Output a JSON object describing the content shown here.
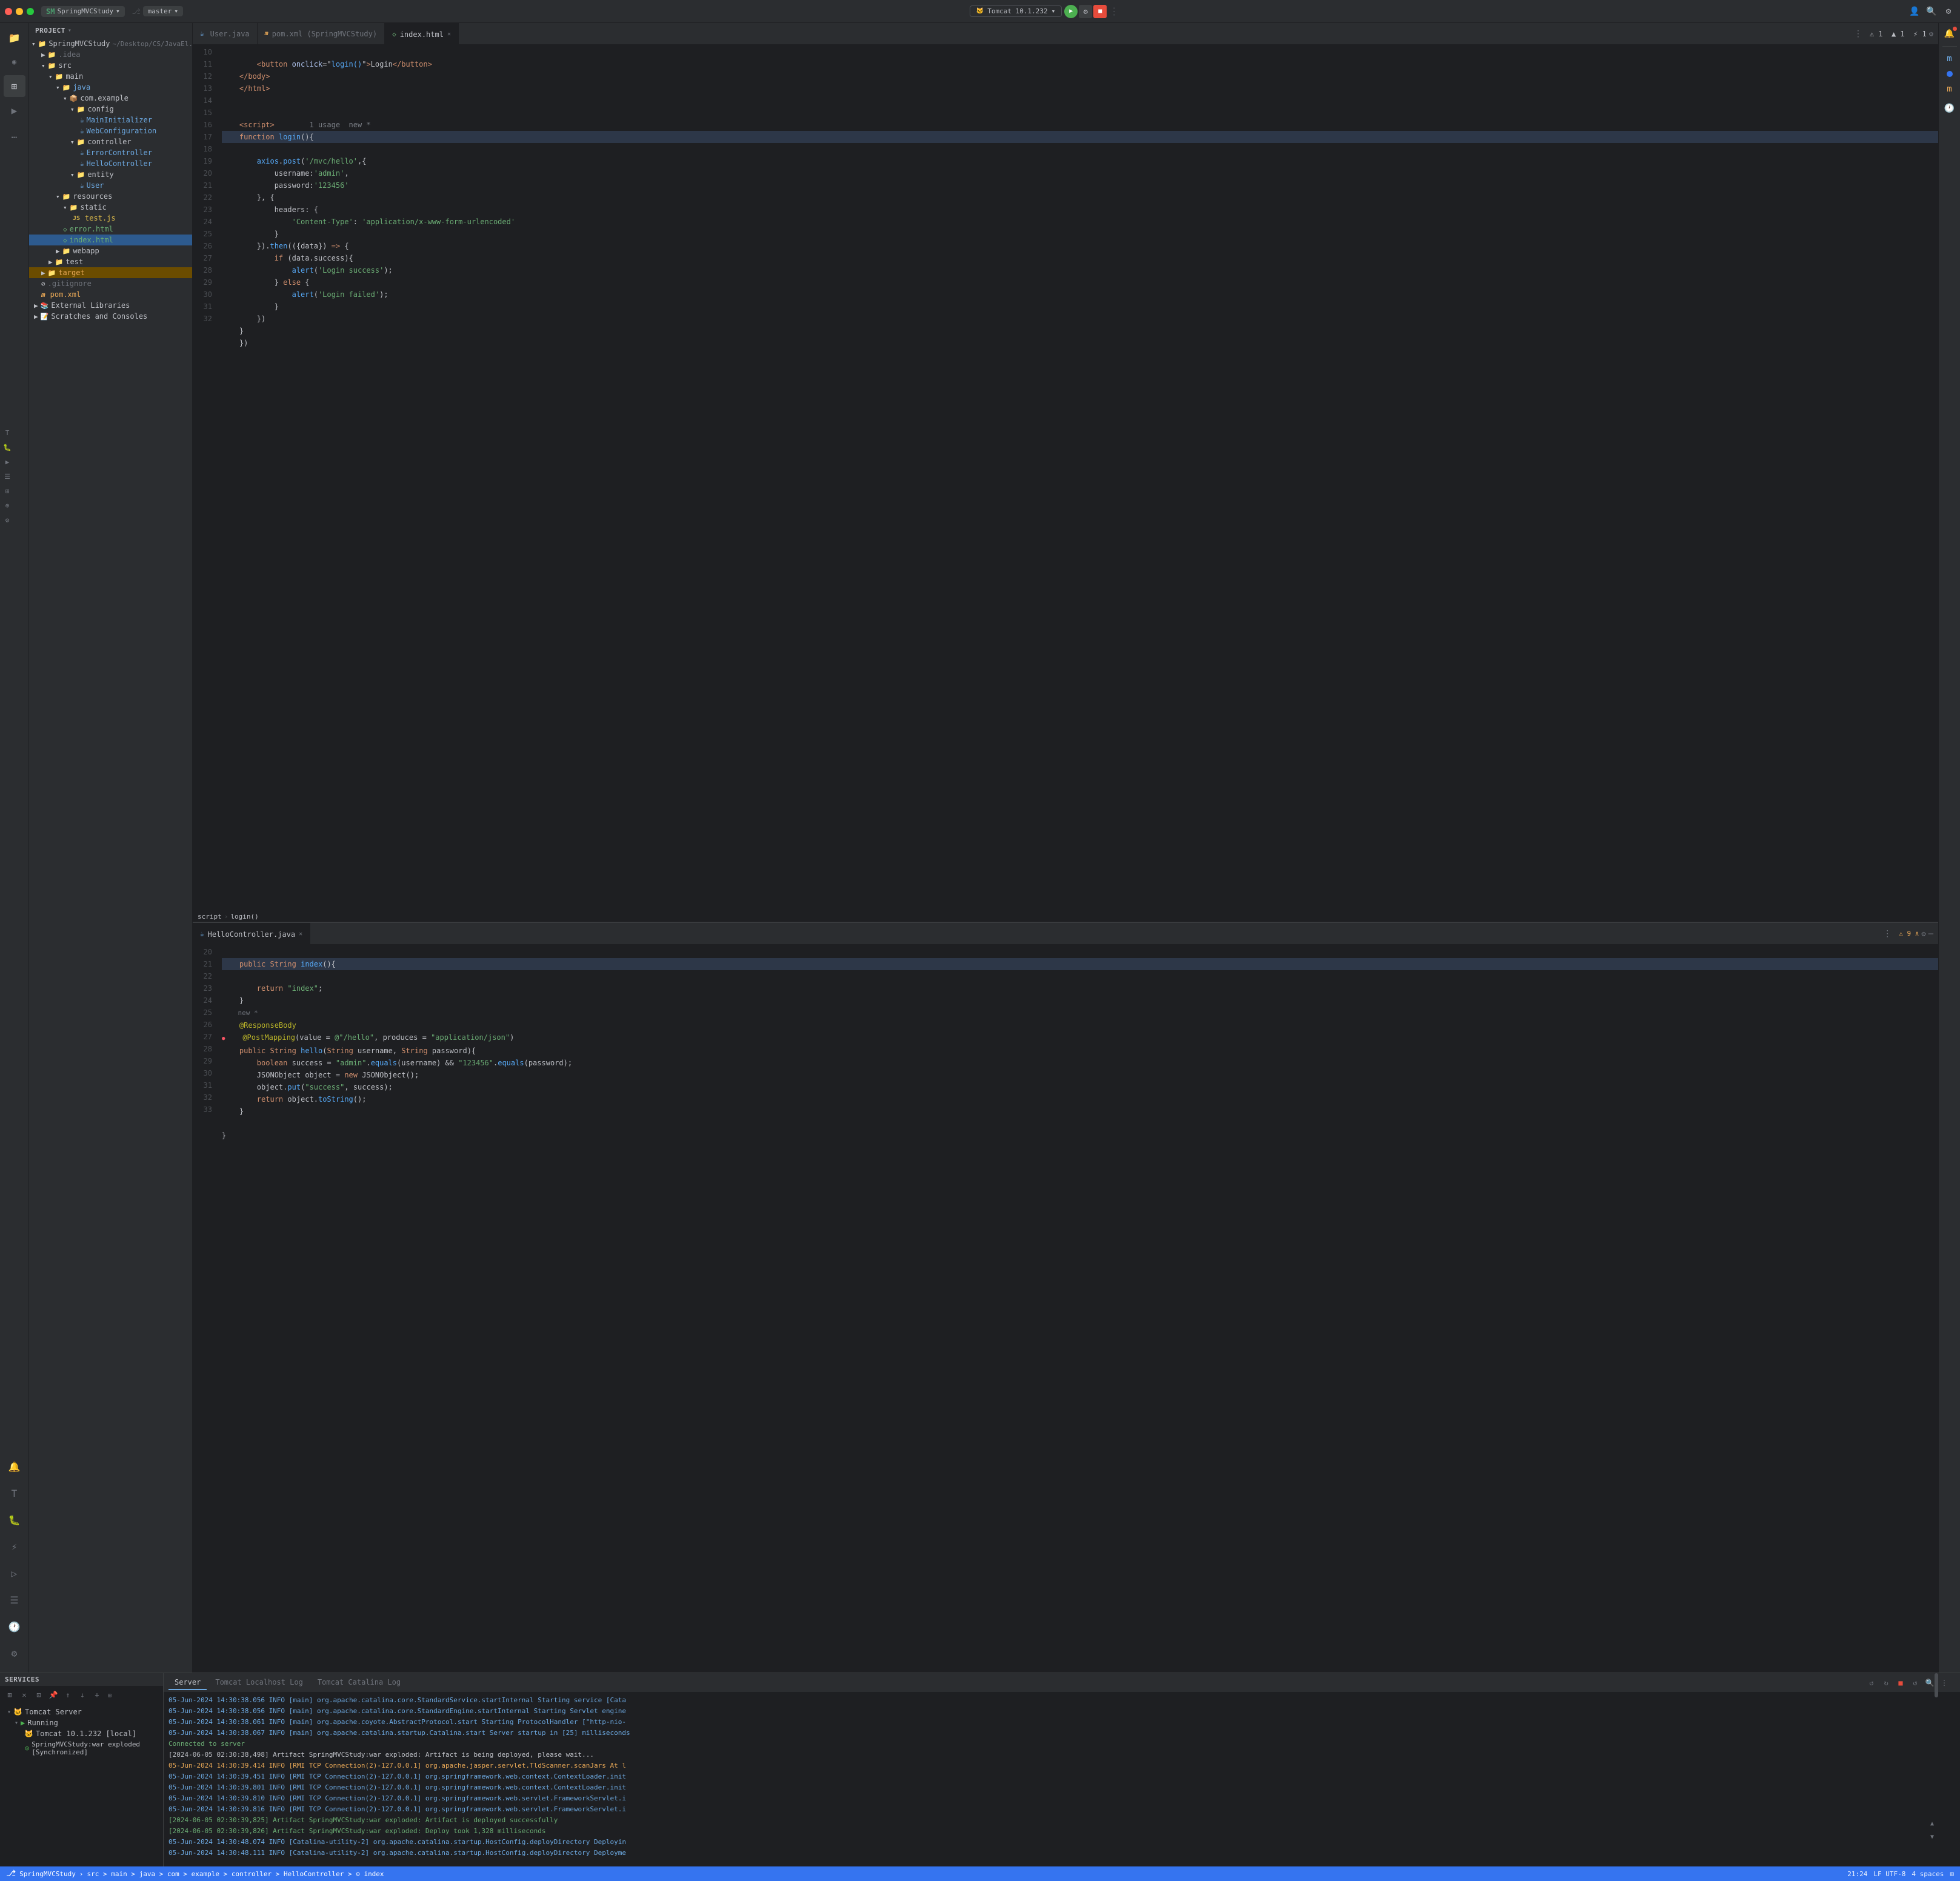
{
  "titlebar": {
    "project_label": "SpringMVCStudy",
    "branch_label": "master",
    "run_config": "Tomcat 10.1.232",
    "chevron": "▼",
    "branch_icon": "⎇"
  },
  "tabs_top": {
    "tab1": {
      "label": "User.java",
      "icon": "☕",
      "active": false
    },
    "tab2": {
      "label": "pom.xml (SpringMVCStudy)",
      "icon": "m",
      "active": false
    },
    "tab3": {
      "label": "index.html",
      "icon": "<>",
      "active": true
    }
  },
  "editor1": {
    "toolbar": {
      "warnings": "⚠ 1  ▲ 1  ⚡ 1  ∧"
    }
  },
  "tabs_mid": {
    "tab1": {
      "label": "HelloController.java",
      "icon": "☕",
      "active": true
    }
  },
  "sidebar": {
    "header": "Project",
    "items": [
      {
        "label": "SpringMVCStudy",
        "path": "~/Desktop/CS/JavaEl",
        "level": 0,
        "icon": "📁",
        "expanded": true
      },
      {
        "label": ".idea",
        "level": 1,
        "icon": "📁",
        "expanded": false
      },
      {
        "label": "src",
        "level": 1,
        "icon": "📁",
        "expanded": true
      },
      {
        "label": "main",
        "level": 2,
        "icon": "📁",
        "expanded": true
      },
      {
        "label": "java",
        "level": 3,
        "icon": "📁",
        "expanded": true
      },
      {
        "label": "com.example",
        "level": 4,
        "icon": "📦",
        "expanded": true
      },
      {
        "label": "config",
        "level": 5,
        "icon": "📁",
        "expanded": true
      },
      {
        "label": "MainInitializer",
        "level": 6,
        "icon": "☕",
        "color": "blue"
      },
      {
        "label": "WebConfiguration",
        "level": 6,
        "icon": "☕",
        "color": "blue"
      },
      {
        "label": "controller",
        "level": 5,
        "icon": "📁",
        "expanded": true
      },
      {
        "label": "ErrorController",
        "level": 6,
        "icon": "☕",
        "color": "blue"
      },
      {
        "label": "HelloController",
        "level": 6,
        "icon": "☕",
        "color": "blue"
      },
      {
        "label": "entity",
        "level": 5,
        "icon": "📁",
        "expanded": true
      },
      {
        "label": "User",
        "level": 6,
        "icon": "☕",
        "color": "blue"
      },
      {
        "label": "resources",
        "level": 3,
        "icon": "📁",
        "expanded": true
      },
      {
        "label": "static",
        "level": 4,
        "icon": "📁",
        "expanded": true
      },
      {
        "label": "test.js",
        "level": 5,
        "icon": "JS",
        "color": "yellow"
      },
      {
        "label": "error.html",
        "level": 4,
        "icon": "◇",
        "color": "green"
      },
      {
        "label": "index.html",
        "level": 4,
        "icon": "◇",
        "color": "green",
        "selected": true
      },
      {
        "label": "webapp",
        "level": 3,
        "icon": "📁",
        "expanded": false
      },
      {
        "label": "test",
        "level": 2,
        "icon": "📁",
        "expanded": false
      },
      {
        "label": "target",
        "level": 1,
        "icon": "📁",
        "color": "orange",
        "expanded": false
      },
      {
        "label": ".gitignore",
        "level": 1,
        "icon": "⊘",
        "color": "grey"
      },
      {
        "label": "pom.xml",
        "level": 1,
        "icon": "m",
        "color": "orange"
      },
      {
        "label": "External Libraries",
        "level": 0,
        "icon": "📚",
        "expanded": false
      },
      {
        "label": "Scratches and Consoles",
        "level": 0,
        "icon": "📝",
        "expanded": false
      }
    ]
  },
  "code_index_html": [
    {
      "num": "10",
      "text": "        <button onclick=\"login()\">Login</button>",
      "tokens": [
        {
          "t": "tag",
          "v": "        <button "
        },
        {
          "t": "attr",
          "v": "onclick"
        },
        {
          "t": "punct",
          "v": "=\""
        },
        {
          "t": "str",
          "v": "login()"
        },
        {
          "t": "punct",
          "v": "\""
        },
        {
          "t": "tag",
          "v": ">"
        },
        {
          "t": "var",
          "v": "Login"
        },
        {
          "t": "tag",
          "v": "</button>"
        }
      ]
    },
    {
      "num": "11",
      "text": "    </body>"
    },
    {
      "num": "12",
      "text": "    </html>"
    },
    {
      "num": "13",
      "text": ""
    },
    {
      "num": "14",
      "text": ""
    },
    {
      "num": "15",
      "text": "    <script>",
      "note": "1 usage  new *"
    },
    {
      "num": "16",
      "text": "    function login(){",
      "highlight": true
    },
    {
      "num": "17",
      "text": "        axios.post('/mvc/hello',{"
    },
    {
      "num": "18",
      "text": "            username:'admin',"
    },
    {
      "num": "19",
      "text": "            password:'123456'"
    },
    {
      "num": "20",
      "text": "        }, {"
    },
    {
      "num": "21",
      "text": "            headers: {"
    },
    {
      "num": "22",
      "text": "                'Content-Type': 'application/x-www-form-urlencoded'"
    },
    {
      "num": "23",
      "text": "            }"
    },
    {
      "num": "24",
      "text": "        }).then(({data}) => {"
    },
    {
      "num": "25",
      "text": "            if (data.success){"
    },
    {
      "num": "26",
      "text": "                alert('Login success');"
    },
    {
      "num": "27",
      "text": "            } else {"
    },
    {
      "num": "28",
      "text": "                alert('Login failed');"
    },
    {
      "num": "29",
      "text": "            }"
    },
    {
      "num": "30",
      "text": "        })"
    },
    {
      "num": "31",
      "text": "    }"
    },
    {
      "num": "32",
      "text": "    })"
    }
  ],
  "breadcrumb_index": {
    "parts": [
      "script",
      ">",
      "login()"
    ]
  },
  "code_hello_controller": [
    {
      "num": "20",
      "text": "    public String index(){",
      "highlight": true
    },
    {
      "num": "21",
      "text": "        return \"index\";"
    },
    {
      "num": "22",
      "text": "    }",
      "note_new": "new *"
    },
    {
      "num": "23",
      "text": ""
    },
    {
      "num": "24",
      "text": "    @ResponseBody"
    },
    {
      "num": "25",
      "text": "    @PostMapping(value = @\"/hello\", produces = \"application/json\")",
      "has_dot": true
    },
    {
      "num": "26",
      "text": "    public String hello(String username, String password){"
    },
    {
      "num": "27",
      "text": "        boolean success = \"admin\".equals(username) && \"123456\".equals(password);"
    },
    {
      "num": "28",
      "text": "        JSONObject object = new JSONObject();"
    },
    {
      "num": "29",
      "text": "        object.put(\"success\", success);"
    },
    {
      "num": "30",
      "text": "        return object.toString();"
    },
    {
      "num": "31",
      "text": "    }"
    },
    {
      "num": "32",
      "text": ""
    },
    {
      "num": "33",
      "text": "}"
    }
  ],
  "services": {
    "header": "Services",
    "items": [
      {
        "label": "Tomcat Server",
        "icon": "🐱",
        "level": 0,
        "expanded": true
      },
      {
        "label": "Running",
        "icon": "▶",
        "level": 1,
        "running": true,
        "expanded": true
      },
      {
        "label": "Tomcat 10.1.232 [local]",
        "icon": "🐱",
        "level": 2
      },
      {
        "label": "SpringMVCStudy:war exploded [Synchronized]",
        "icon": "⊙",
        "level": 3
      }
    ]
  },
  "log_tabs": {
    "server": "Server",
    "localhost": "Tomcat Localhost Log",
    "catalina": "Tomcat Catalina Log"
  },
  "log_lines": [
    {
      "type": "info",
      "text": "05-Jun-2024 14:30:38.056 INFO [main] org.apache.catalina.core.StandardService.startInternal Starting service [Cata"
    },
    {
      "type": "info",
      "text": "05-Jun-2024 14:30:38.056 INFO [main] org.apache.catalina.core.StandardEngine.startInternal Starting Servlet engine"
    },
    {
      "type": "info",
      "text": "05-Jun-2024 14:30:38.061 INFO [main] org.apache.coyote.AbstractProtocol.start Starting ProtocolHandler [\"http-nio-"
    },
    {
      "type": "info",
      "text": "05-Jun-2024 14:30:38.067 INFO [main] org.apache.catalina.startup.Catalina.start Server startup in [25] milliseconds"
    },
    {
      "type": "success",
      "text": "Connected to server"
    },
    {
      "type": "normal",
      "text": "[2024-06-05 02:30:38,498] Artifact SpringMVCStudy:war exploded: Artifact is being deployed, please wait..."
    },
    {
      "type": "warn",
      "text": "05-Jun-2024 14:30:39.414 INFO [RMI TCP Connection(2)-127.0.0.1] org.apache.jasper.servlet.TldScanner.scanJars At l"
    },
    {
      "type": "info",
      "text": "05-Jun-2024 14:30:39.451 INFO [RMI TCP Connection(2)-127.0.0.1] org.springframework.web.context.ContextLoader.init"
    },
    {
      "type": "info",
      "text": "05-Jun-2024 14:30:39.801 INFO [RMI TCP Connection(2)-127.0.0.1] org.springframework.web.context.ContextLoader.init"
    },
    {
      "type": "info",
      "text": "05-Jun-2024 14:30:39.810 INFO [RMI TCP Connection(2)-127.0.0.1] org.springframework.web.servlet.FrameworkServlet.i"
    },
    {
      "type": "info",
      "text": "05-Jun-2024 14:30:39.816 INFO [RMI TCP Connection(2)-127.0.0.1] org.springframework.web.servlet.FrameworkServlet.i"
    },
    {
      "type": "success",
      "text": "[2024-06-05 02:30:39,825] Artifact SpringMVCStudy:war exploded: Artifact is deployed successfully"
    },
    {
      "type": "success",
      "text": "[2024-06-05 02:30:39,826] Artifact SpringMVCStudy:war exploded: Deploy took 1,328 milliseconds"
    },
    {
      "type": "info",
      "text": "05-Jun-2024 14:30:48.074 INFO [Catalina-utility-2] org.apache.catalina.startup.HostConfig.deployDirectory Deployin"
    },
    {
      "type": "info",
      "text": "05-Jun-2024 14:30:48.111 INFO [Catalina-utility-2] org.apache.catalina.startup.HostConfig.deployDirectory Deployme"
    }
  ],
  "status_bar": {
    "project": "SpringMVCStudy",
    "breadcrumb": "src > main > java > com > example > controller > HelloController > ⊙ index",
    "position": "21:24",
    "encoding": "LF  UTF-8",
    "indent": "4 spaces"
  }
}
